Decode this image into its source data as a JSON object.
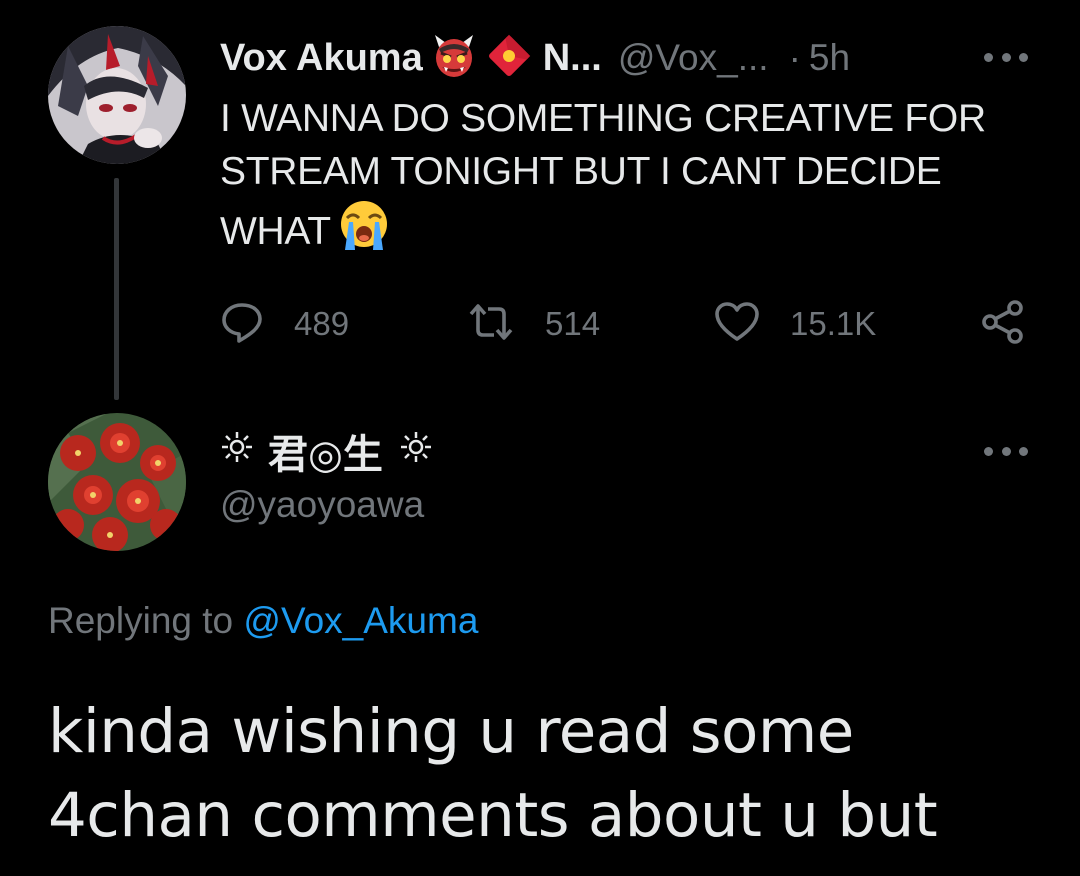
{
  "parent_tweet": {
    "display_name": "Vox Akuma",
    "name_truncated": "N...",
    "handle": "@Vox_...",
    "separator": "·",
    "time": "5h",
    "text": "I WANNA DO SOMETHING CREATIVE FOR STREAM TONIGHT BUT I CANT DECIDE WHAT",
    "emojis": [
      "japanese-ogre-icon",
      "red-envelope-icon",
      "loudly-crying-face-icon"
    ],
    "actions": {
      "replies": "489",
      "retweets": "514",
      "likes": "15.1K"
    }
  },
  "reply_tweet": {
    "display_name": "君◎生",
    "handle": "@yaoyoawa",
    "replying_label": "Replying to",
    "replying_to": "@Vox_Akuma",
    "text": "kinda wishing u read some 4chan comments about u but"
  },
  "colors": {
    "background": "#000000",
    "text": "#e7e9ea",
    "muted": "#71767b",
    "link": "#1d9bf0",
    "thread_line": "#333639"
  }
}
